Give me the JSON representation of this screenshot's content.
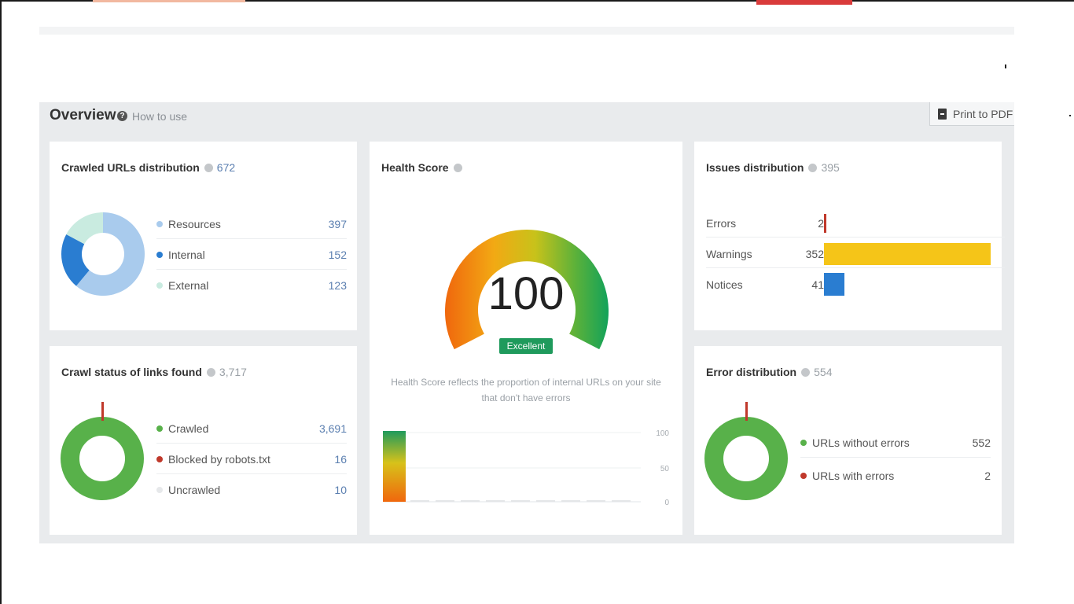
{
  "overview": {
    "title": "Overview",
    "how_to_use": "How to use",
    "print_label": "Print to PDF"
  },
  "crawled_urls": {
    "title": "Crawled URLs distribution",
    "count": "672",
    "items": [
      {
        "label": "Resources",
        "value": "397",
        "color": "#a9cbed"
      },
      {
        "label": "Internal",
        "value": "152",
        "color": "#2a7dd1"
      },
      {
        "label": "External",
        "value": "123",
        "color": "#c9ebe0"
      }
    ]
  },
  "health": {
    "title": "Health Score",
    "score": "100",
    "badge": "Excellent",
    "description": "Health Score reflects the proportion of internal URLs on your site that don't have errors",
    "axis": [
      "100",
      "50",
      "0"
    ]
  },
  "issues": {
    "title": "Issues distribution",
    "count": "395",
    "rows": [
      {
        "label": "Errors",
        "value": "2",
        "color": "#c0392b"
      },
      {
        "label": "Warnings",
        "value": "352",
        "color": "#f5c518"
      },
      {
        "label": "Notices",
        "value": "41",
        "color": "#2a7dd1"
      }
    ]
  },
  "crawl_status": {
    "title": "Crawl status of links found",
    "count": "3,717",
    "items": [
      {
        "label": "Crawled",
        "value": "3,691",
        "color": "#58b14a"
      },
      {
        "label": "Blocked by robots.txt",
        "value": "16",
        "color": "#c0392b"
      },
      {
        "label": "Uncrawled",
        "value": "10",
        "color": "#e6e8ea"
      }
    ]
  },
  "errors": {
    "title": "Error distribution",
    "count": "554",
    "items": [
      {
        "label": "URLs without errors",
        "value": "552",
        "color": "#58b14a"
      },
      {
        "label": "URLs with errors",
        "value": "2",
        "color": "#c0392b"
      }
    ]
  }
}
